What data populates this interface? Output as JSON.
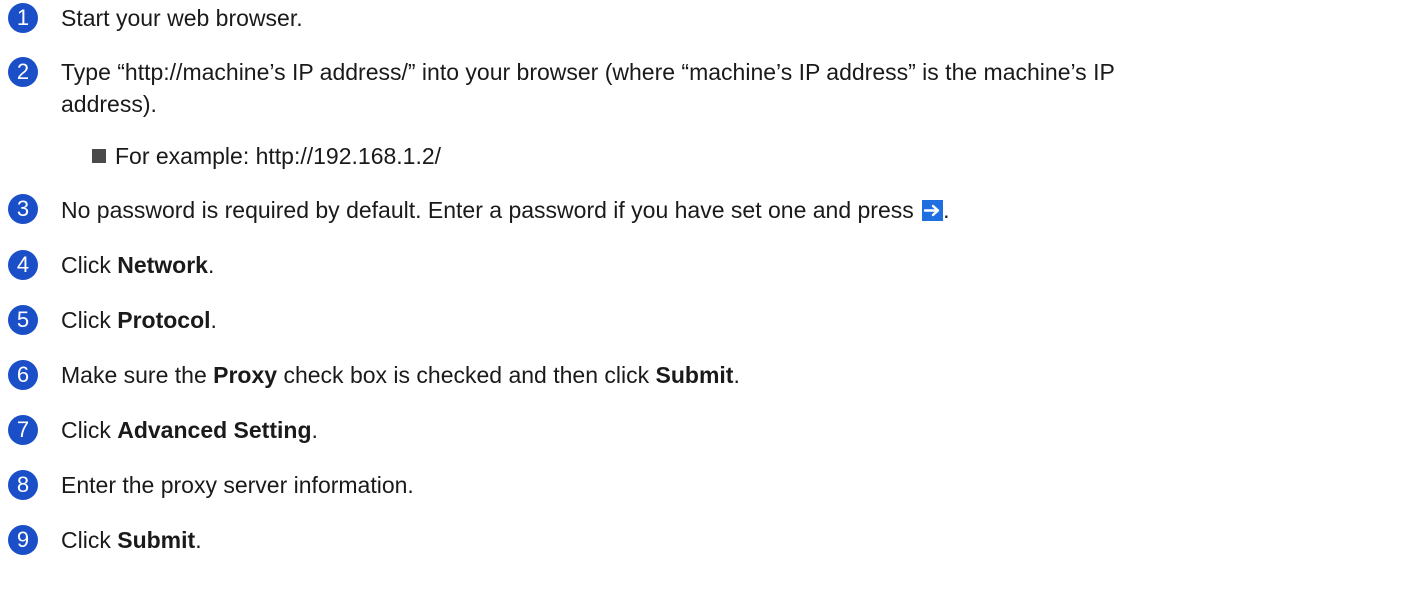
{
  "steps": [
    {
      "number": "1",
      "text": "Start your web browser."
    },
    {
      "number": "2",
      "line1": "Type “http://machine’s IP address/” into your browser (where “machine’s IP address” is the machine’s IP",
      "line2": "address).",
      "bullet": "For example: http://192.168.1.2/"
    },
    {
      "number": "3",
      "text": "No password is required by default. Enter a password if you have set one and press",
      "suffix": "."
    },
    {
      "number": "4",
      "prefix": "Click ",
      "bold": "Network",
      "suffix": "."
    },
    {
      "number": "5",
      "prefix": "Click ",
      "bold": "Protocol",
      "suffix": "."
    },
    {
      "number": "6",
      "prefix": "Make sure the ",
      "bold": "Proxy",
      "middle": " check box is checked and then click ",
      "bold2": "Submit",
      "suffix": "."
    },
    {
      "number": "7",
      "prefix": "Click ",
      "bold": "Advanced Setting",
      "suffix": "."
    },
    {
      "number": "8",
      "text": "Enter the proxy server information."
    },
    {
      "number": "9",
      "prefix": "Click ",
      "bold": "Submit",
      "suffix": "."
    }
  ],
  "icons": {
    "go_arrow": "right-arrow-icon",
    "accent_color": "#1a4fc8"
  }
}
